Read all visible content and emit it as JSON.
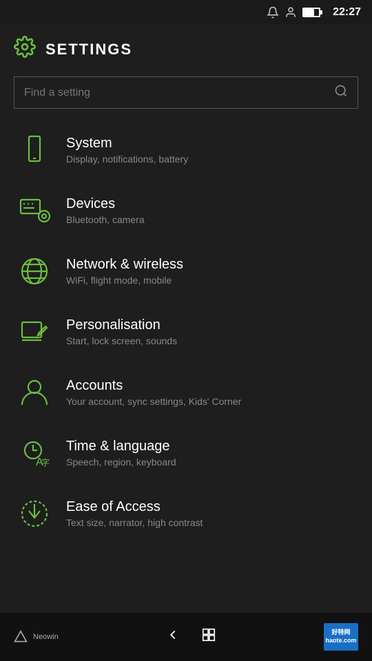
{
  "status": {
    "time": "22:27",
    "battery_level": 70
  },
  "header": {
    "title": "SETTINGS",
    "icon": "⚙"
  },
  "search": {
    "placeholder": "Find a setting"
  },
  "settings_items": [
    {
      "id": "system",
      "title": "System",
      "subtitle": "Display, notifications, battery"
    },
    {
      "id": "devices",
      "title": "Devices",
      "subtitle": "Bluetooth, camera"
    },
    {
      "id": "network",
      "title": "Network & wireless",
      "subtitle": "WiFi, flight mode, mobile"
    },
    {
      "id": "personalisation",
      "title": "Personalisation",
      "subtitle": "Start, lock screen, sounds"
    },
    {
      "id": "accounts",
      "title": "Accounts",
      "subtitle": "Your account, sync settings, Kids' Corner"
    },
    {
      "id": "time-language",
      "title": "Time & language",
      "subtitle": "Speech, region, keyboard"
    },
    {
      "id": "ease-of-access",
      "title": "Ease of Access",
      "subtitle": "Text size, narrator, high contrast"
    }
  ],
  "bottom_nav": {
    "brand": "Neowin",
    "back_label": "←",
    "windows_label": "⊞",
    "watermark": "好特网\nhaote.com"
  }
}
